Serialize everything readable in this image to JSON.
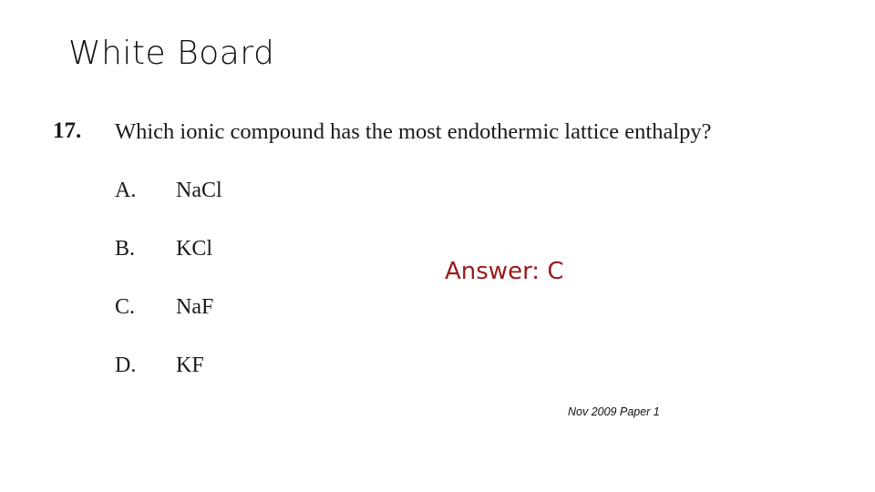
{
  "slide": {
    "title": "White Board"
  },
  "question": {
    "number": "17.",
    "text": "Which ionic compound has the most endothermic lattice enthalpy?",
    "options": [
      {
        "letter": "A.",
        "text": "NaCl"
      },
      {
        "letter": "B.",
        "text": "KCl"
      },
      {
        "letter": "C.",
        "text": "NaF"
      },
      {
        "letter": "D.",
        "text": "KF"
      }
    ]
  },
  "answer": {
    "text": "Answer: C",
    "color": "#9b1b1b"
  },
  "source": {
    "text": "Nov 2009 Paper 1"
  }
}
